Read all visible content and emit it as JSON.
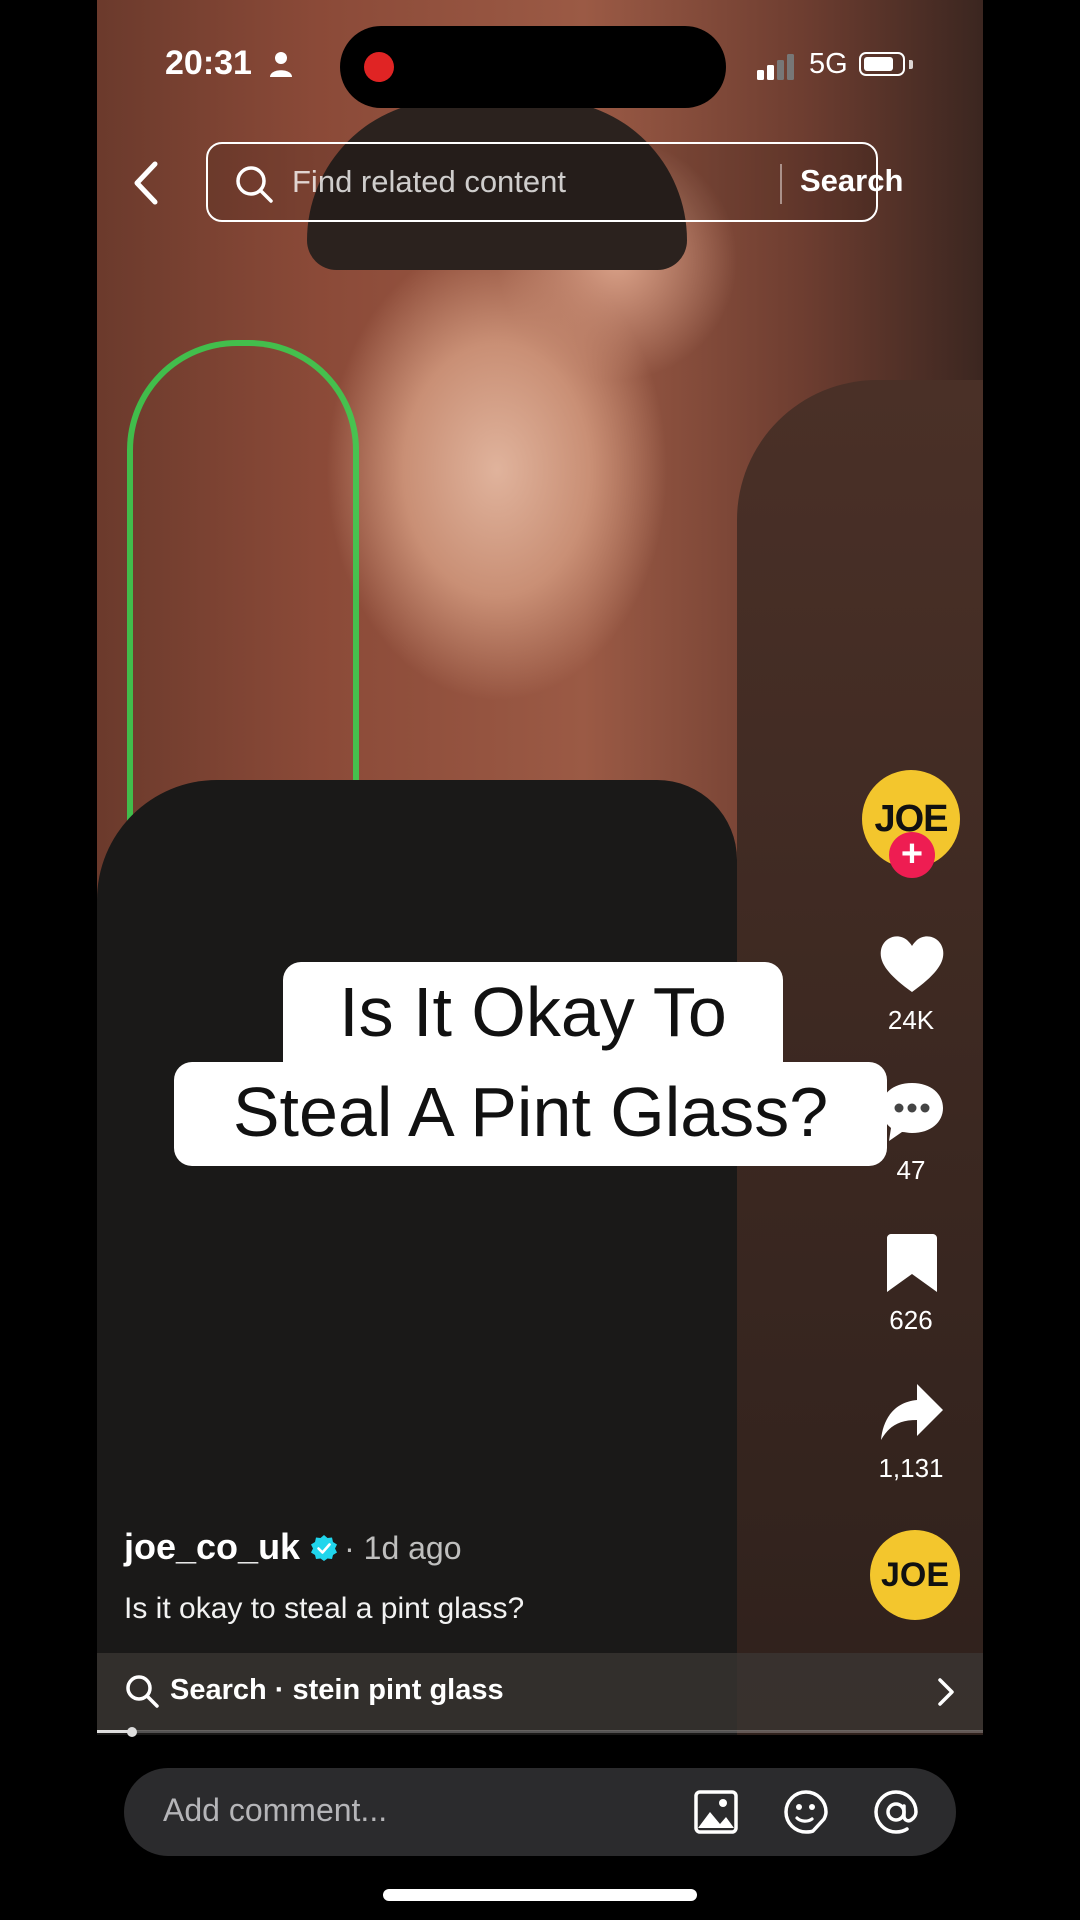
{
  "status_bar": {
    "time": "20:31",
    "network": "5G",
    "battery_level": 0.75
  },
  "search": {
    "placeholder": "Find related content",
    "button_label": "Search"
  },
  "video": {
    "caption_line1": "Is It Okay To",
    "caption_line2": "Steal A Pint Glass?"
  },
  "profile": {
    "avatar_text": "JOE",
    "follow_symbol": "+"
  },
  "actions": {
    "likes": "24K",
    "comments": "47",
    "saves": "626",
    "shares": "1,131"
  },
  "post": {
    "author": "joe_co_uk",
    "time": "· 1d ago",
    "description": "Is it okay to steal a pint glass?"
  },
  "sound": {
    "disc_text": "JOE"
  },
  "related": {
    "label": "Search · stein pint glass"
  },
  "progress": {
    "fraction": 0.04
  },
  "comment": {
    "placeholder": "Add comment..."
  },
  "icons": [
    "person-icon",
    "back-icon",
    "search-icon",
    "heart-icon",
    "comment-icon",
    "bookmark-icon",
    "share-icon",
    "verified-icon",
    "chevron-right-icon",
    "image-icon",
    "emoji-icon",
    "mention-icon"
  ]
}
